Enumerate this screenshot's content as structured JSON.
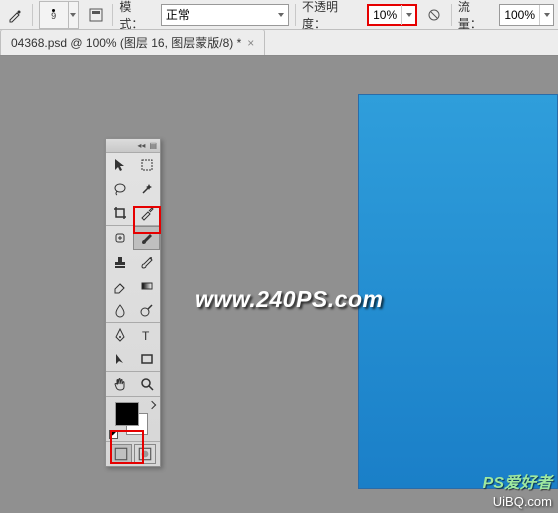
{
  "toolbar": {
    "brush_size": "9",
    "mode_label": "模式：",
    "mode_value": "正常",
    "opacity_label": "不透明度：",
    "opacity_value": "10%",
    "flow_label": "流量：",
    "flow_value": "100%"
  },
  "tab": {
    "title": "04368.psd @ 100% (图层 16, 图层蒙版/8) *"
  },
  "watermarks": {
    "main": "www.240PS.com",
    "br1": "PS爱好者",
    "br2": "UiBQ.com"
  },
  "icons": {
    "brush": "brush-icon",
    "toggle": "panel-toggle-icon",
    "airbrush": "airbrush-icon"
  }
}
